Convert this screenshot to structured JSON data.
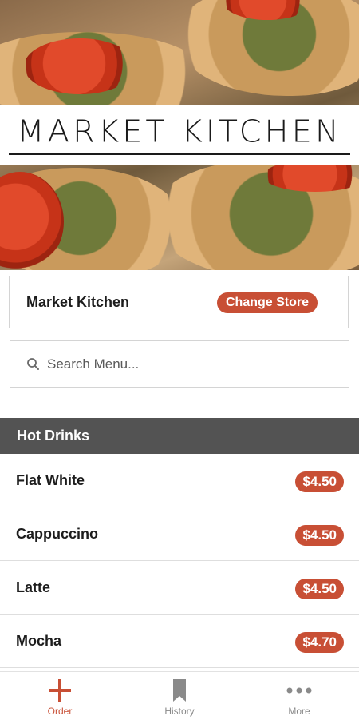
{
  "hero": {
    "logo_text": "MARKET KITCHEN"
  },
  "store": {
    "name": "Market Kitchen",
    "change_label": "Change Store"
  },
  "search": {
    "placeholder": "Search Menu..."
  },
  "menu": {
    "category": "Hot Drinks",
    "items": [
      {
        "name": "Flat White",
        "price": "$4.50"
      },
      {
        "name": "Cappuccino",
        "price": "$4.50"
      },
      {
        "name": "Latte",
        "price": "$4.50"
      },
      {
        "name": "Mocha",
        "price": "$4.70"
      }
    ]
  },
  "nav": {
    "items": [
      {
        "label": "Order",
        "icon": "plus-icon",
        "active": true
      },
      {
        "label": "History",
        "icon": "bookmark-icon",
        "active": false
      },
      {
        "label": "More",
        "icon": "more-dots-icon",
        "active": false
      }
    ]
  },
  "colors": {
    "accent": "#c84f35",
    "category_bar": "#535353"
  }
}
